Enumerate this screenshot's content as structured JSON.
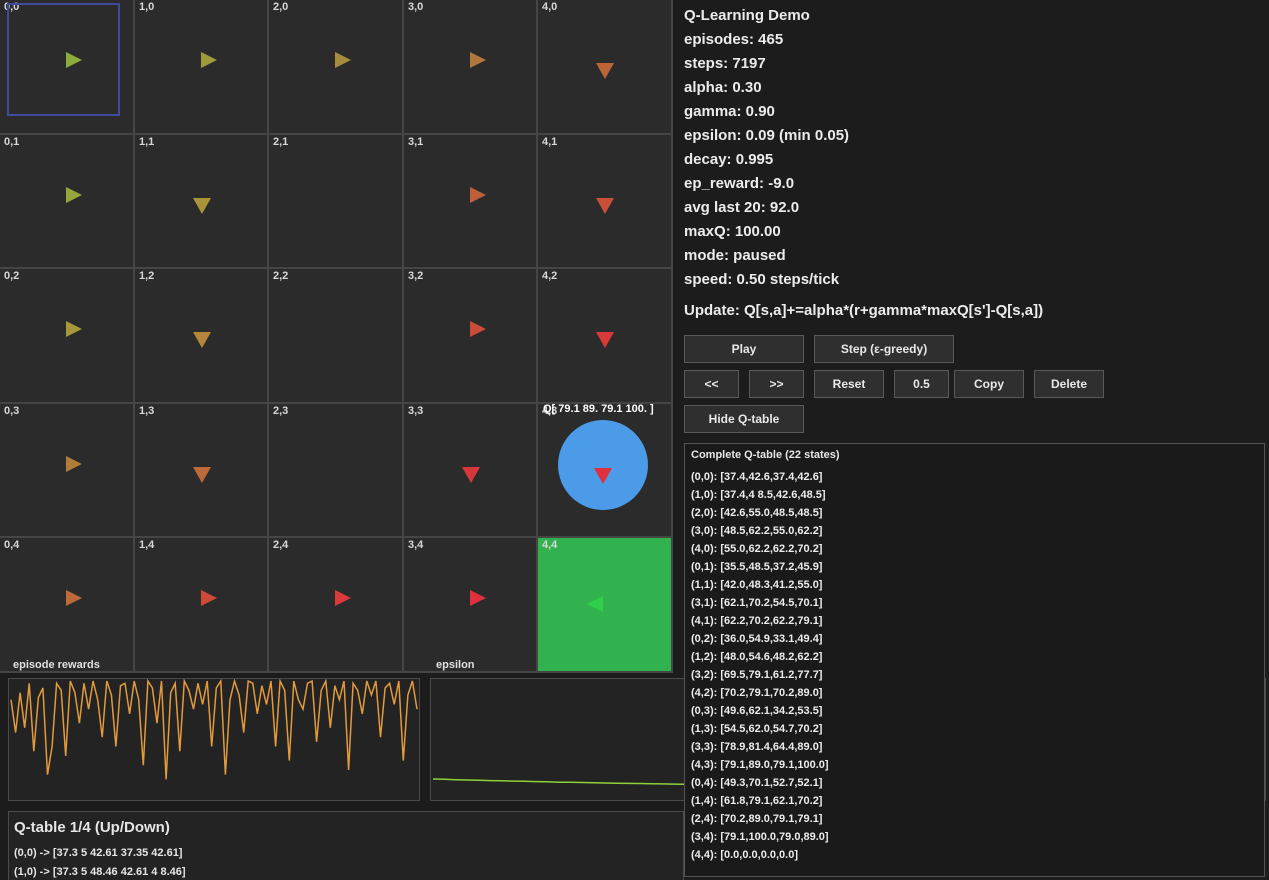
{
  "grid": {
    "cols": 5,
    "rows": 5,
    "cells": [
      {
        "label": "0,0",
        "dir": "right",
        "color": "#8cab3a"
      },
      {
        "label": "1,0",
        "dir": "right",
        "color": "#9c9c3a"
      },
      {
        "label": "2,0",
        "dir": "right",
        "color": "#a68c3a"
      },
      {
        "label": "3,0",
        "dir": "right",
        "color": "#b0783a"
      },
      {
        "label": "4,0",
        "dir": "down",
        "color": "#bb6535"
      },
      {
        "label": "0,1",
        "dir": "right",
        "color": "#96a63a"
      },
      {
        "label": "1,1",
        "dir": "down",
        "color": "#a8953a"
      },
      {
        "label": "2,1",
        "dir": "none",
        "color": ""
      },
      {
        "label": "3,1",
        "dir": "right",
        "color": "#c0603a"
      },
      {
        "label": "4,1",
        "dir": "down",
        "color": "#c94f37"
      },
      {
        "label": "0,2",
        "dir": "right",
        "color": "#a6983a"
      },
      {
        "label": "1,2",
        "dir": "down",
        "color": "#b4853a"
      },
      {
        "label": "2,2",
        "dir": "none",
        "color": ""
      },
      {
        "label": "3,2",
        "dir": "right",
        "color": "#cc4a38"
      },
      {
        "label": "4,2",
        "dir": "down",
        "color": "#d93a39"
      },
      {
        "label": "0,3",
        "dir": "right",
        "color": "#b27b3a"
      },
      {
        "label": "1,3",
        "dir": "down",
        "color": "#bc6a3a"
      },
      {
        "label": "2,3",
        "dir": "none",
        "color": ""
      },
      {
        "label": "3,3",
        "dir": "down",
        "color": "#d6373a"
      },
      {
        "label": "4,3",
        "dir": "down",
        "color": "#e0303e"
      },
      {
        "label": "0,4",
        "dir": "right",
        "color": "#bc6a3a"
      },
      {
        "label": "1,4",
        "dir": "right",
        "color": "#cf4a38"
      },
      {
        "label": "2,4",
        "dir": "right",
        "color": "#da3a3a"
      },
      {
        "label": "3,4",
        "dir": "right",
        "color": "#e0303e"
      },
      {
        "label": "4,4",
        "dir": "left",
        "color": "#2ed04a",
        "goal": true
      }
    ],
    "agent_q": "Q[ 79.1  89.  79.1 100. ]"
  },
  "info": {
    "title": "Q-Learning Demo",
    "stats": [
      "episodes: 465",
      "steps: 7197",
      "alpha: 0.30",
      "gamma: 0.90",
      "epsilon: 0.09 (min 0.05)",
      "decay: 0.995",
      "ep_reward: -9.0",
      "avg last 20: 92.0",
      "maxQ: 100.00",
      "mode: paused",
      "speed: 0.50 steps/tick"
    ],
    "update": "Update: Q[s,a]+=alpha*(r+gamma*maxQ[s']-Q[s,a])"
  },
  "buttons": {
    "play": "Play",
    "step": "Step (ε-greedy)",
    "back": "<<",
    "fwd": ">>",
    "reset": "Reset",
    "speed": "0.5",
    "copy": "Copy",
    "delete": "Delete",
    "hide": "Hide Q-table"
  },
  "plots": {
    "rewards_title": "episode rewards",
    "epsilon_title": "epsilon",
    "rewards": [
      92,
      78,
      95,
      80,
      99,
      70,
      93,
      97,
      60,
      72,
      99,
      96,
      68,
      100,
      95,
      82,
      99,
      88,
      100,
      92,
      76,
      100,
      94,
      72,
      98,
      99,
      86,
      100,
      92,
      64,
      100,
      97,
      82,
      100,
      58,
      95,
      99,
      70,
      100,
      96,
      88,
      99,
      90,
      100,
      72,
      97,
      100,
      60,
      92,
      100,
      94,
      78,
      100,
      99,
      86,
      98,
      90,
      100,
      72,
      100,
      96,
      66,
      100,
      92,
      88,
      99,
      100,
      74,
      96,
      100,
      80,
      98,
      92,
      100,
      62,
      99,
      96,
      86,
      100,
      94,
      100,
      76,
      97,
      99,
      90,
      100,
      66,
      94,
      100,
      88
    ],
    "epsilon": [
      0.12,
      0.118,
      0.116,
      0.114,
      0.113,
      0.111,
      0.11,
      0.108,
      0.107,
      0.105,
      0.104,
      0.102,
      0.101,
      0.1,
      0.098,
      0.097,
      0.096,
      0.095,
      0.094,
      0.093,
      0.092,
      0.091,
      0.09
    ]
  },
  "qtable_view": {
    "title": "Q-table 1/4 (Up/Down)",
    "rows": [
      "(0,0) -> [37.3 5 42.61 37.35 42.61]",
      "(1,0) -> [37.3 5 48.46 42.61 4 8.46]"
    ]
  },
  "complete_table": {
    "title": "Complete Q-table (22 states)",
    "entries": [
      "(0,0): [37.4,42.6,37.4,42.6]",
      "(1,0): [37.4,4 8.5,42.6,48.5]",
      "(2,0): [42.6,55.0,48.5,48.5]",
      "(3,0): [48.5,62.2,55.0,62.2]",
      "(4,0): [55.0,62.2,62.2,70.2]",
      "(0,1): [35.5,48.5,37.2,45.9]",
      "(1,1): [42.0,48.3,41.2,55.0]",
      "(3,1): [62.1,70.2,54.5,70.1]",
      "(4,1): [62.2,70.2,62.2,79.1]",
      "(0,2): [36.0,54.9,33.1,49.4]",
      "(1,2): [48.0,54.6,48.2,62.2]",
      "(3,2): [69.5,79.1,61.2,77.7]",
      "(4,2): [70.2,79.1,70.2,89.0]",
      "(0,3): [49.6,62.1,34.2,53.5]",
      "(1,3): [54.5,62.0,54.7,70.2]",
      "(3,3): [78.9,81.4,64.4,89.0]",
      "(4,3): [79.1,89.0,79.1,100.0]",
      "(0,4): [49.3,70.1,52.7,52.1]",
      "(1,4): [61.8,79.1,62.1,70.2]",
      "(2,4): [70.2,89.0,79.1,79.1]",
      "(3,4): [79.1,100.0,79.0,89.0]",
      "(4,4): [0.0,0.0,0.0,0.0]"
    ]
  }
}
